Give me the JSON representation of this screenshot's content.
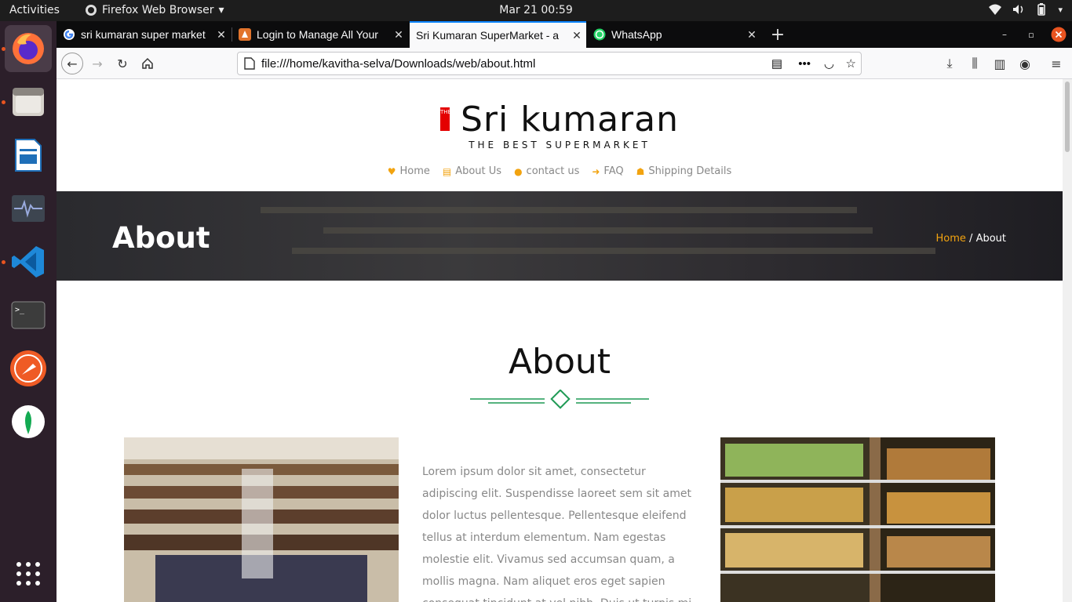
{
  "system": {
    "activities": "Activities",
    "app_menu": "Firefox Web Browser",
    "clock": "Mar 21  00:59"
  },
  "tabs": [
    {
      "title": "sri kumaran super market",
      "color": "#4285f4"
    },
    {
      "title": "Login to Manage All Your",
      "color": "#e2742c"
    },
    {
      "title": "Sri Kumaran SuperMarket - a",
      "color": "#ffffff"
    },
    {
      "title": "WhatsApp",
      "color": "#25d366"
    }
  ],
  "url": "file:///home/kavitha-selva/Downloads/web/about.html",
  "site": {
    "the_label": "THE",
    "brand": "Sri kumaran",
    "tagline": "THE BEST SUPERMARKET",
    "menu": [
      {
        "label": "Home",
        "icon": "heart-icon"
      },
      {
        "label": "About Us",
        "icon": "document-icon"
      },
      {
        "label": "contact us",
        "icon": "user-icon"
      },
      {
        "label": "FAQ",
        "icon": "arrow-right-icon"
      },
      {
        "label": "Shipping Details",
        "icon": "shipping-icon"
      }
    ],
    "banner_title": "About",
    "breadcrumb": {
      "home": "Home",
      "sep": "/",
      "current": "About"
    },
    "section_title": "About",
    "paragraph": "Lorem ipsum dolor sit amet, consectetur adipiscing elit. Suspendisse laoreet sem sit amet dolor luctus pellentesque. Pellentesque eleifend tellus at interdum elementum. Nam egestas molestie elit. Vivamus sed accumsan quam, a mollis magna. Nam aliquet eros eget sapien consequat tincidunt at vel nibh. Duis ut turpis mi"
  },
  "colors": {
    "accent": "#f2a30f",
    "divider": "#1f9a55",
    "dock": "#2c1f2a"
  }
}
